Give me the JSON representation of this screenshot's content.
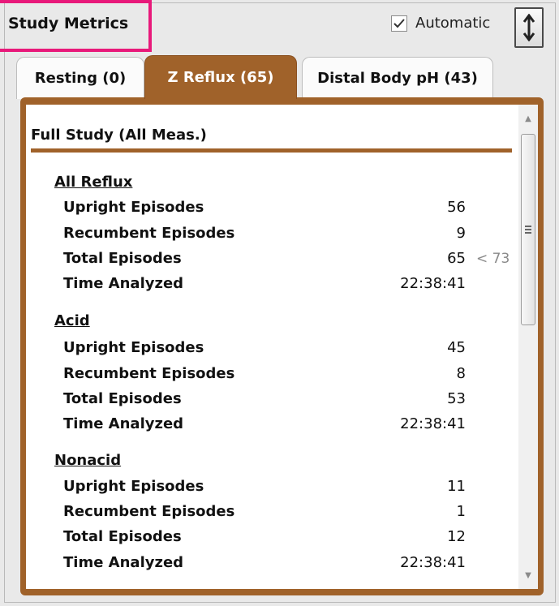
{
  "header": {
    "title": "Study Metrics",
    "automatic_label": "Automatic",
    "automatic_checked": true
  },
  "tabs": [
    {
      "label": "Resting (0)",
      "active": false
    },
    {
      "label": "Z Reflux (65)",
      "active": true
    },
    {
      "label": "Distal Body pH (43)",
      "active": false
    }
  ],
  "colors": {
    "accent": "#a0622a",
    "highlight_box": "#e8197a"
  },
  "content": {
    "section_title": "Full Study (All Meas.)",
    "groups": [
      {
        "title": "All Reflux",
        "rows": [
          {
            "label": "Upright Episodes",
            "value": "56"
          },
          {
            "label": "Recumbent Episodes",
            "value": "9"
          },
          {
            "label": "Total Episodes",
            "value": "65",
            "limit": "< 73"
          },
          {
            "label": "Time Analyzed",
            "value": "22:38:41"
          }
        ]
      },
      {
        "title": "Acid",
        "rows": [
          {
            "label": "Upright Episodes",
            "value": "45"
          },
          {
            "label": "Recumbent Episodes",
            "value": "8"
          },
          {
            "label": "Total Episodes",
            "value": "53"
          },
          {
            "label": "Time Analyzed",
            "value": "22:38:41"
          }
        ]
      },
      {
        "title": "Nonacid",
        "rows": [
          {
            "label": "Upright Episodes",
            "value": "11"
          },
          {
            "label": "Recumbent Episodes",
            "value": "1"
          },
          {
            "label": "Total Episodes",
            "value": "12"
          },
          {
            "label": "Time Analyzed",
            "value": "22:38:41"
          }
        ]
      }
    ]
  },
  "icons": {
    "expand": "vertical-expand-icon",
    "checkbox": "checkmark-icon",
    "scroll_up": "scroll-up-arrow-icon",
    "scroll_down": "scroll-down-arrow-icon"
  }
}
